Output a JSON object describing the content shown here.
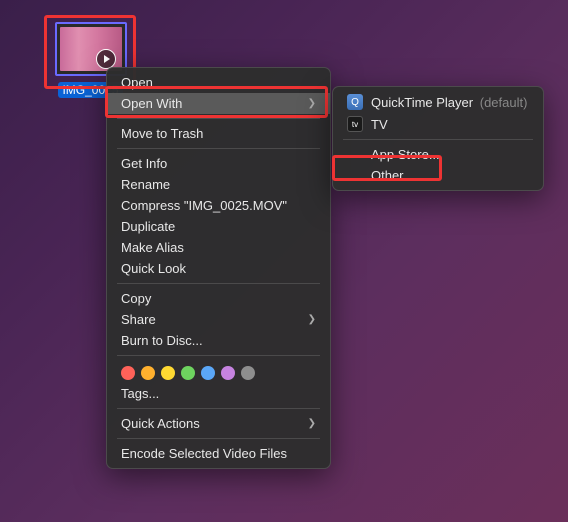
{
  "file": {
    "name": "IMG_0025"
  },
  "contextMenu": {
    "open": "Open",
    "openWith": "Open With",
    "moveToTrash": "Move to Trash",
    "getInfo": "Get Info",
    "rename": "Rename",
    "compress": "Compress \"IMG_0025.MOV\"",
    "duplicate": "Duplicate",
    "makeAlias": "Make Alias",
    "quickLook": "Quick Look",
    "copy": "Copy",
    "share": "Share",
    "burnToDisc": "Burn to Disc...",
    "tags": "Tags...",
    "quickActions": "Quick Actions",
    "encode": "Encode Selected Video Files"
  },
  "openWithMenu": {
    "quicktime": "QuickTime Player",
    "defaultSuffix": "(default)",
    "tv": "TV",
    "appStore": "App Store...",
    "other": "Other..."
  },
  "tagColors": [
    "red",
    "orange",
    "yellow",
    "green",
    "blue",
    "purple",
    "gray"
  ]
}
